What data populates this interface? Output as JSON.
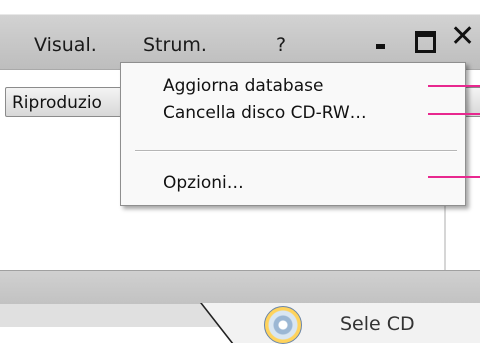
{
  "menubar": {
    "items": [
      "Visual.",
      "Strum.",
      "?"
    ]
  },
  "window_controls": {
    "minimize": "minimize-icon",
    "maximize": "maximize-icon",
    "close": "close-icon",
    "close_glyph": "✕"
  },
  "toolbar": {
    "tab_label": "Riproduzio"
  },
  "dropdown": {
    "items": [
      "Aggiorna database",
      "Cancella disco CD-RW…",
      "Opzioni…"
    ]
  },
  "bottom": {
    "tab_label": "Sele CD",
    "disc_icon": "cd-disc-icon"
  },
  "colors": {
    "callout": "#e8288f",
    "menubar": "#c8c8c8",
    "dropdown_bg": "#f9f9f9"
  }
}
